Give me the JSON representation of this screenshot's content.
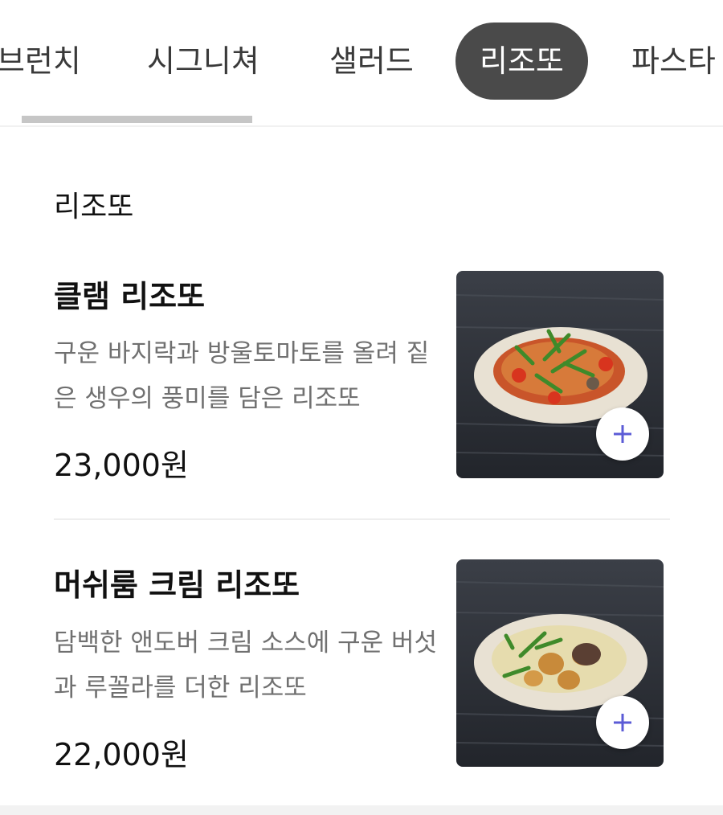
{
  "tabs": [
    {
      "label": "브런치",
      "active": false
    },
    {
      "label": "시그니쳐",
      "active": false
    },
    {
      "label": "샐러드",
      "active": false
    },
    {
      "label": "리조또",
      "active": true
    },
    {
      "label": "파스타",
      "active": false
    }
  ],
  "section": {
    "title": "리조또"
  },
  "items": [
    {
      "name": "클램 리조또",
      "description": "구운 바지락과 방울토마토를 올려 짙은 생우의 풍미를 담은 리조또",
      "price": "23,000원",
      "image_icon": "clam-risotto-photo",
      "add_icon": "plus-icon"
    },
    {
      "name": "머쉬룸 크림 리조또",
      "description": "담백한 앤도버 크림 소스에 구운 버섯과 루꼴라를 더한 리조또",
      "price": "22,000원",
      "image_icon": "mushroom-risotto-photo",
      "add_icon": "plus-icon"
    }
  ],
  "colors": {
    "active_tab_bg": "#4a4a4a",
    "plus_icon": "#5b5bd6",
    "description_text": "#707070"
  }
}
